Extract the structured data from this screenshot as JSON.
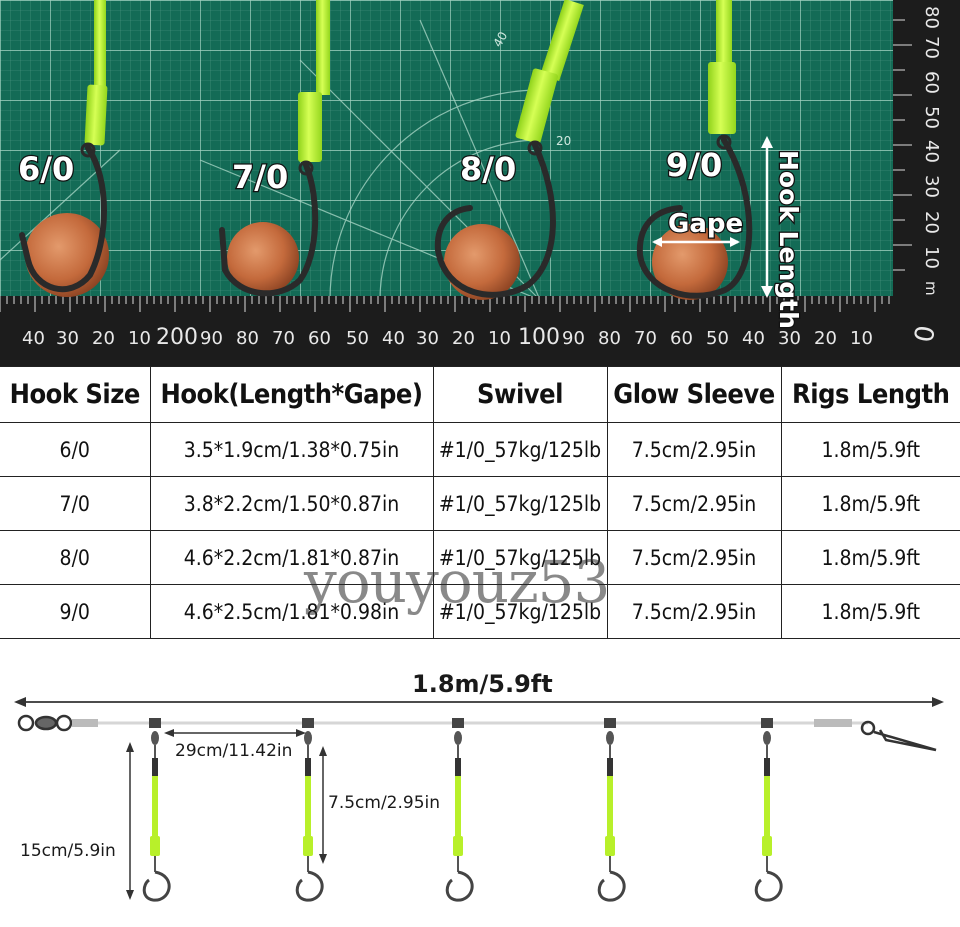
{
  "photo": {
    "hook_labels": [
      "6/0",
      "7/0",
      "8/0",
      "9/0"
    ],
    "gape_label": "Gape",
    "hook_length_label": "Hook Length",
    "ruler_bottom_numbers": [
      "40",
      "30",
      "20",
      "10",
      "200",
      "90",
      "80",
      "70",
      "60",
      "50",
      "40",
      "30",
      "20",
      "10",
      "100",
      "90",
      "80",
      "70",
      "60",
      "50",
      "40",
      "30",
      "20",
      "10",
      "0"
    ],
    "ruler_right_numbers": [
      "80",
      "70",
      "60",
      "50",
      "40",
      "30",
      "20",
      "10",
      "mm"
    ],
    "mat_numbers": [
      "40",
      "20"
    ]
  },
  "table": {
    "headers": [
      "Hook Size",
      "Hook(Length*Gape)",
      "Swivel",
      "Glow Sleeve",
      "Rigs Length"
    ],
    "rows": [
      [
        "6/0",
        "3.5*1.9cm/1.38*0.75in",
        "#1/0_57kg/125lb",
        "7.5cm/2.95in",
        "1.8m/5.9ft"
      ],
      [
        "7/0",
        "3.8*2.2cm/1.50*0.87in",
        "#1/0_57kg/125lb",
        "7.5cm/2.95in",
        "1.8m/5.9ft"
      ],
      [
        "8/0",
        "4.6*2.2cm/1.81*0.87in",
        "#1/0_57kg/125lb",
        "7.5cm/2.95in",
        "1.8m/5.9ft"
      ],
      [
        "9/0",
        "4.6*2.5cm/1.81*0.98in",
        "#1/0_57kg/125lb",
        "7.5cm/2.95in",
        "1.8m/5.9ft"
      ]
    ]
  },
  "watermark": "youyouz53",
  "diagram": {
    "total_length": "1.8m/5.9ft",
    "spacing": "29cm/11.42in",
    "sleeve_length": "7.5cm/2.95in",
    "dropper_length": "15cm/5.9in"
  },
  "colors": {
    "mat_green": "#136b56",
    "grid_line": "#7fb8a6",
    "glow_sleeve": "#b8f02a",
    "ruler_dark": "#1c1c1c",
    "penny": "#c46a3c"
  }
}
